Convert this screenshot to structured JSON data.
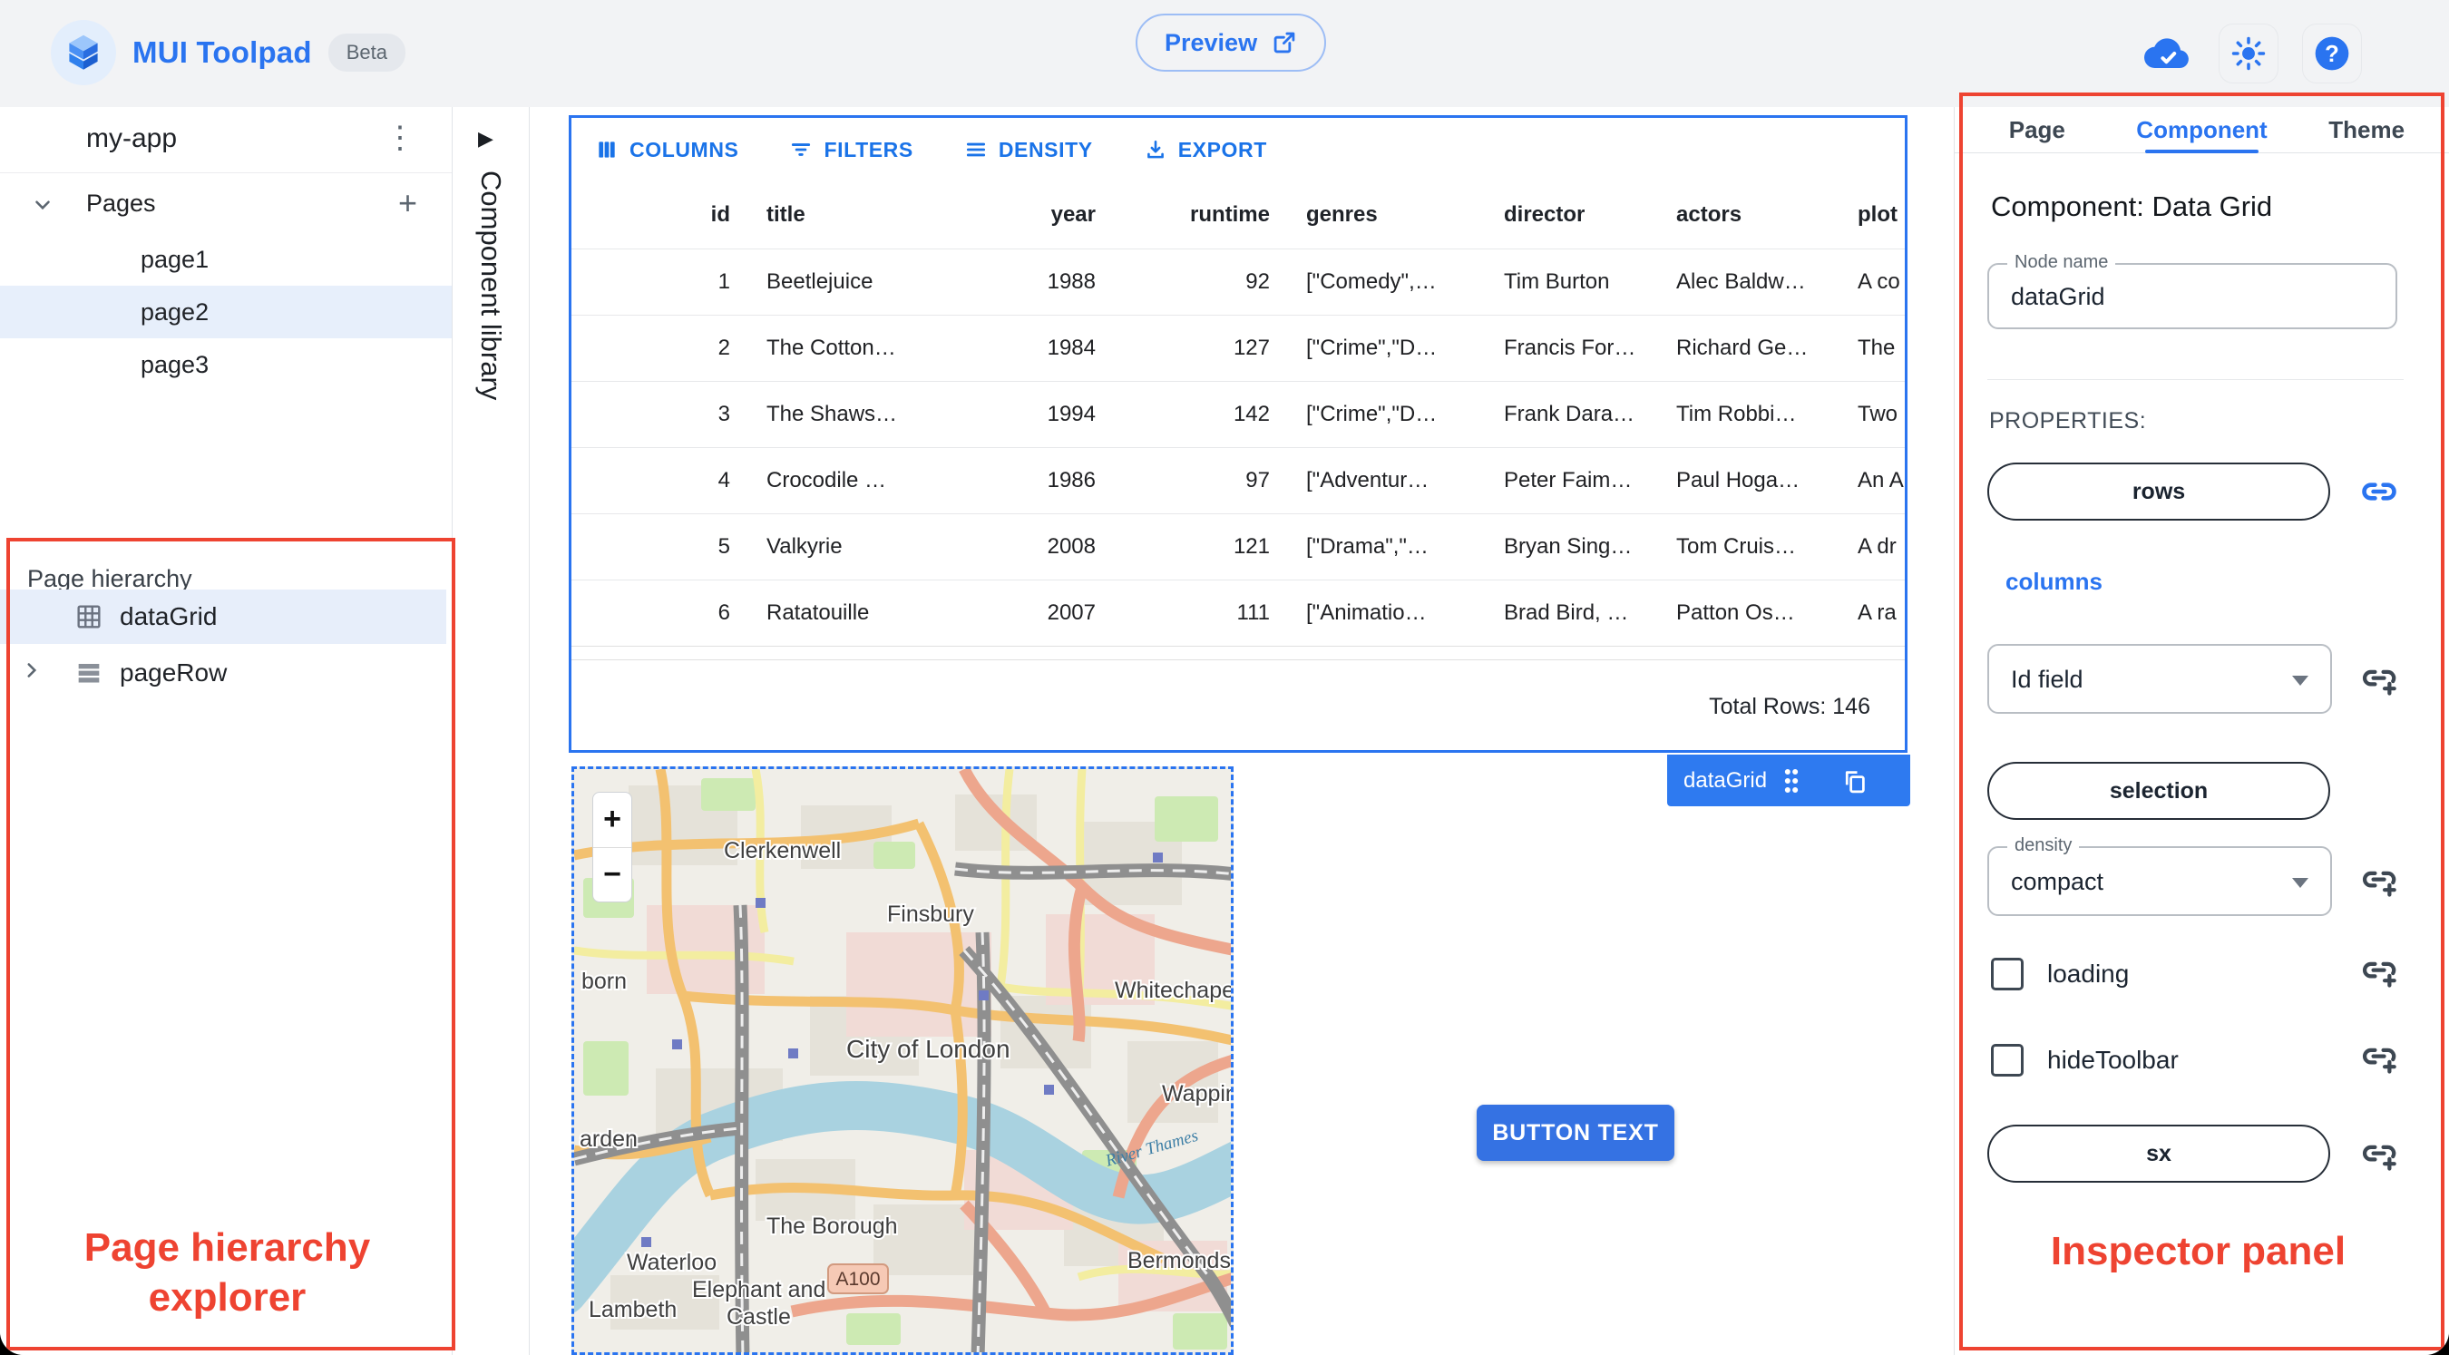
{
  "colors": {
    "accent": "#2a74f0",
    "annotation": "#ee4331",
    "toolbar_blue": "#1a73e8",
    "chip_blue": "#2e7af0"
  },
  "app_bar": {
    "logo_title": "MUI Toolpad",
    "beta_badge": "Beta",
    "preview_button": "Preview",
    "icons": [
      "cloud-done-icon",
      "light-mode-icon",
      "help-icon"
    ]
  },
  "sidebar": {
    "app_name": "my-app",
    "pages": {
      "label": "Pages",
      "items": [
        {
          "label": "page1",
          "selected": false
        },
        {
          "label": "page2",
          "selected": true
        },
        {
          "label": "page3",
          "selected": false
        }
      ]
    },
    "hierarchy": {
      "label": "Page hierarchy",
      "items": [
        {
          "label": "dataGrid",
          "icon": "grid-icon",
          "selected": true
        },
        {
          "label": "pageRow",
          "icon": "rows-icon",
          "selected": false
        }
      ]
    }
  },
  "component_library": {
    "label": "Component library",
    "expand_arrow": "▶"
  },
  "canvas": {
    "datagrid": {
      "toolbar": [
        "COLUMNS",
        "FILTERS",
        "DENSITY",
        "EXPORT"
      ],
      "columns": [
        "id",
        "title",
        "year",
        "runtime",
        "genres",
        "director",
        "actors",
        "plot"
      ],
      "rows": [
        [
          "1",
          "Beetlejuice",
          "1988",
          "92",
          "[\"Comedy\",…",
          "Tim Burton",
          "Alec Baldw…",
          "A co"
        ],
        [
          "2",
          "The Cotton…",
          "1984",
          "127",
          "[\"Crime\",\"D…",
          "Francis For…",
          "Richard Ge…",
          "The"
        ],
        [
          "3",
          "The Shaws…",
          "1994",
          "142",
          "[\"Crime\",\"D…",
          "Frank Dara…",
          "Tim Robbi…",
          "Two"
        ],
        [
          "4",
          "Crocodile …",
          "1986",
          "97",
          "[\"Adventur…",
          "Peter Faim…",
          "Paul Hoga…",
          "An A"
        ],
        [
          "5",
          "Valkyrie",
          "2008",
          "121",
          "[\"Drama\",\"…",
          "Bryan Sing…",
          "Tom Cruis…",
          "A dr"
        ],
        [
          "6",
          "Ratatouille",
          "2007",
          "111",
          "[\"Animatio…",
          "Brad Bird, …",
          "Patton Os…",
          "A ra"
        ]
      ],
      "footer": "Total Rows: 146",
      "selection_chip": "dataGrid"
    },
    "map": {
      "zoom_in": "+",
      "zoom_out": "−",
      "labels": [
        "Clerkenwell",
        "Finsbury",
        "Whitechapel",
        "City of London",
        "born",
        "arden",
        "Waterloo",
        "The Borough",
        "Elephant and",
        "Castle",
        "Lambeth",
        "Bermondsey",
        "Wapping"
      ],
      "river_label": "River Thames",
      "route_badge": "A100"
    },
    "button": {
      "label": "BUTTON TEXT"
    }
  },
  "inspector": {
    "tabs": [
      {
        "label": "Page",
        "active": false
      },
      {
        "label": "Component",
        "active": true
      },
      {
        "label": "Theme",
        "active": false
      }
    ],
    "heading": "Component: Data Grid",
    "node_name": {
      "label": "Node name",
      "value": "dataGrid"
    },
    "properties_label": "PROPERTIES:",
    "rows_button": "rows",
    "columns_link": "columns",
    "id_field_select": "Id field",
    "selection_button": "selection",
    "density_select": {
      "label": "density",
      "value": "compact"
    },
    "checkboxes": [
      {
        "label": "loading",
        "checked": false
      },
      {
        "label": "hideToolbar",
        "checked": false
      }
    ],
    "sx_button": "sx"
  },
  "annotations": {
    "hierarchy_label": "Page hierarchy explorer",
    "inspector_label": "Inspector panel"
  }
}
